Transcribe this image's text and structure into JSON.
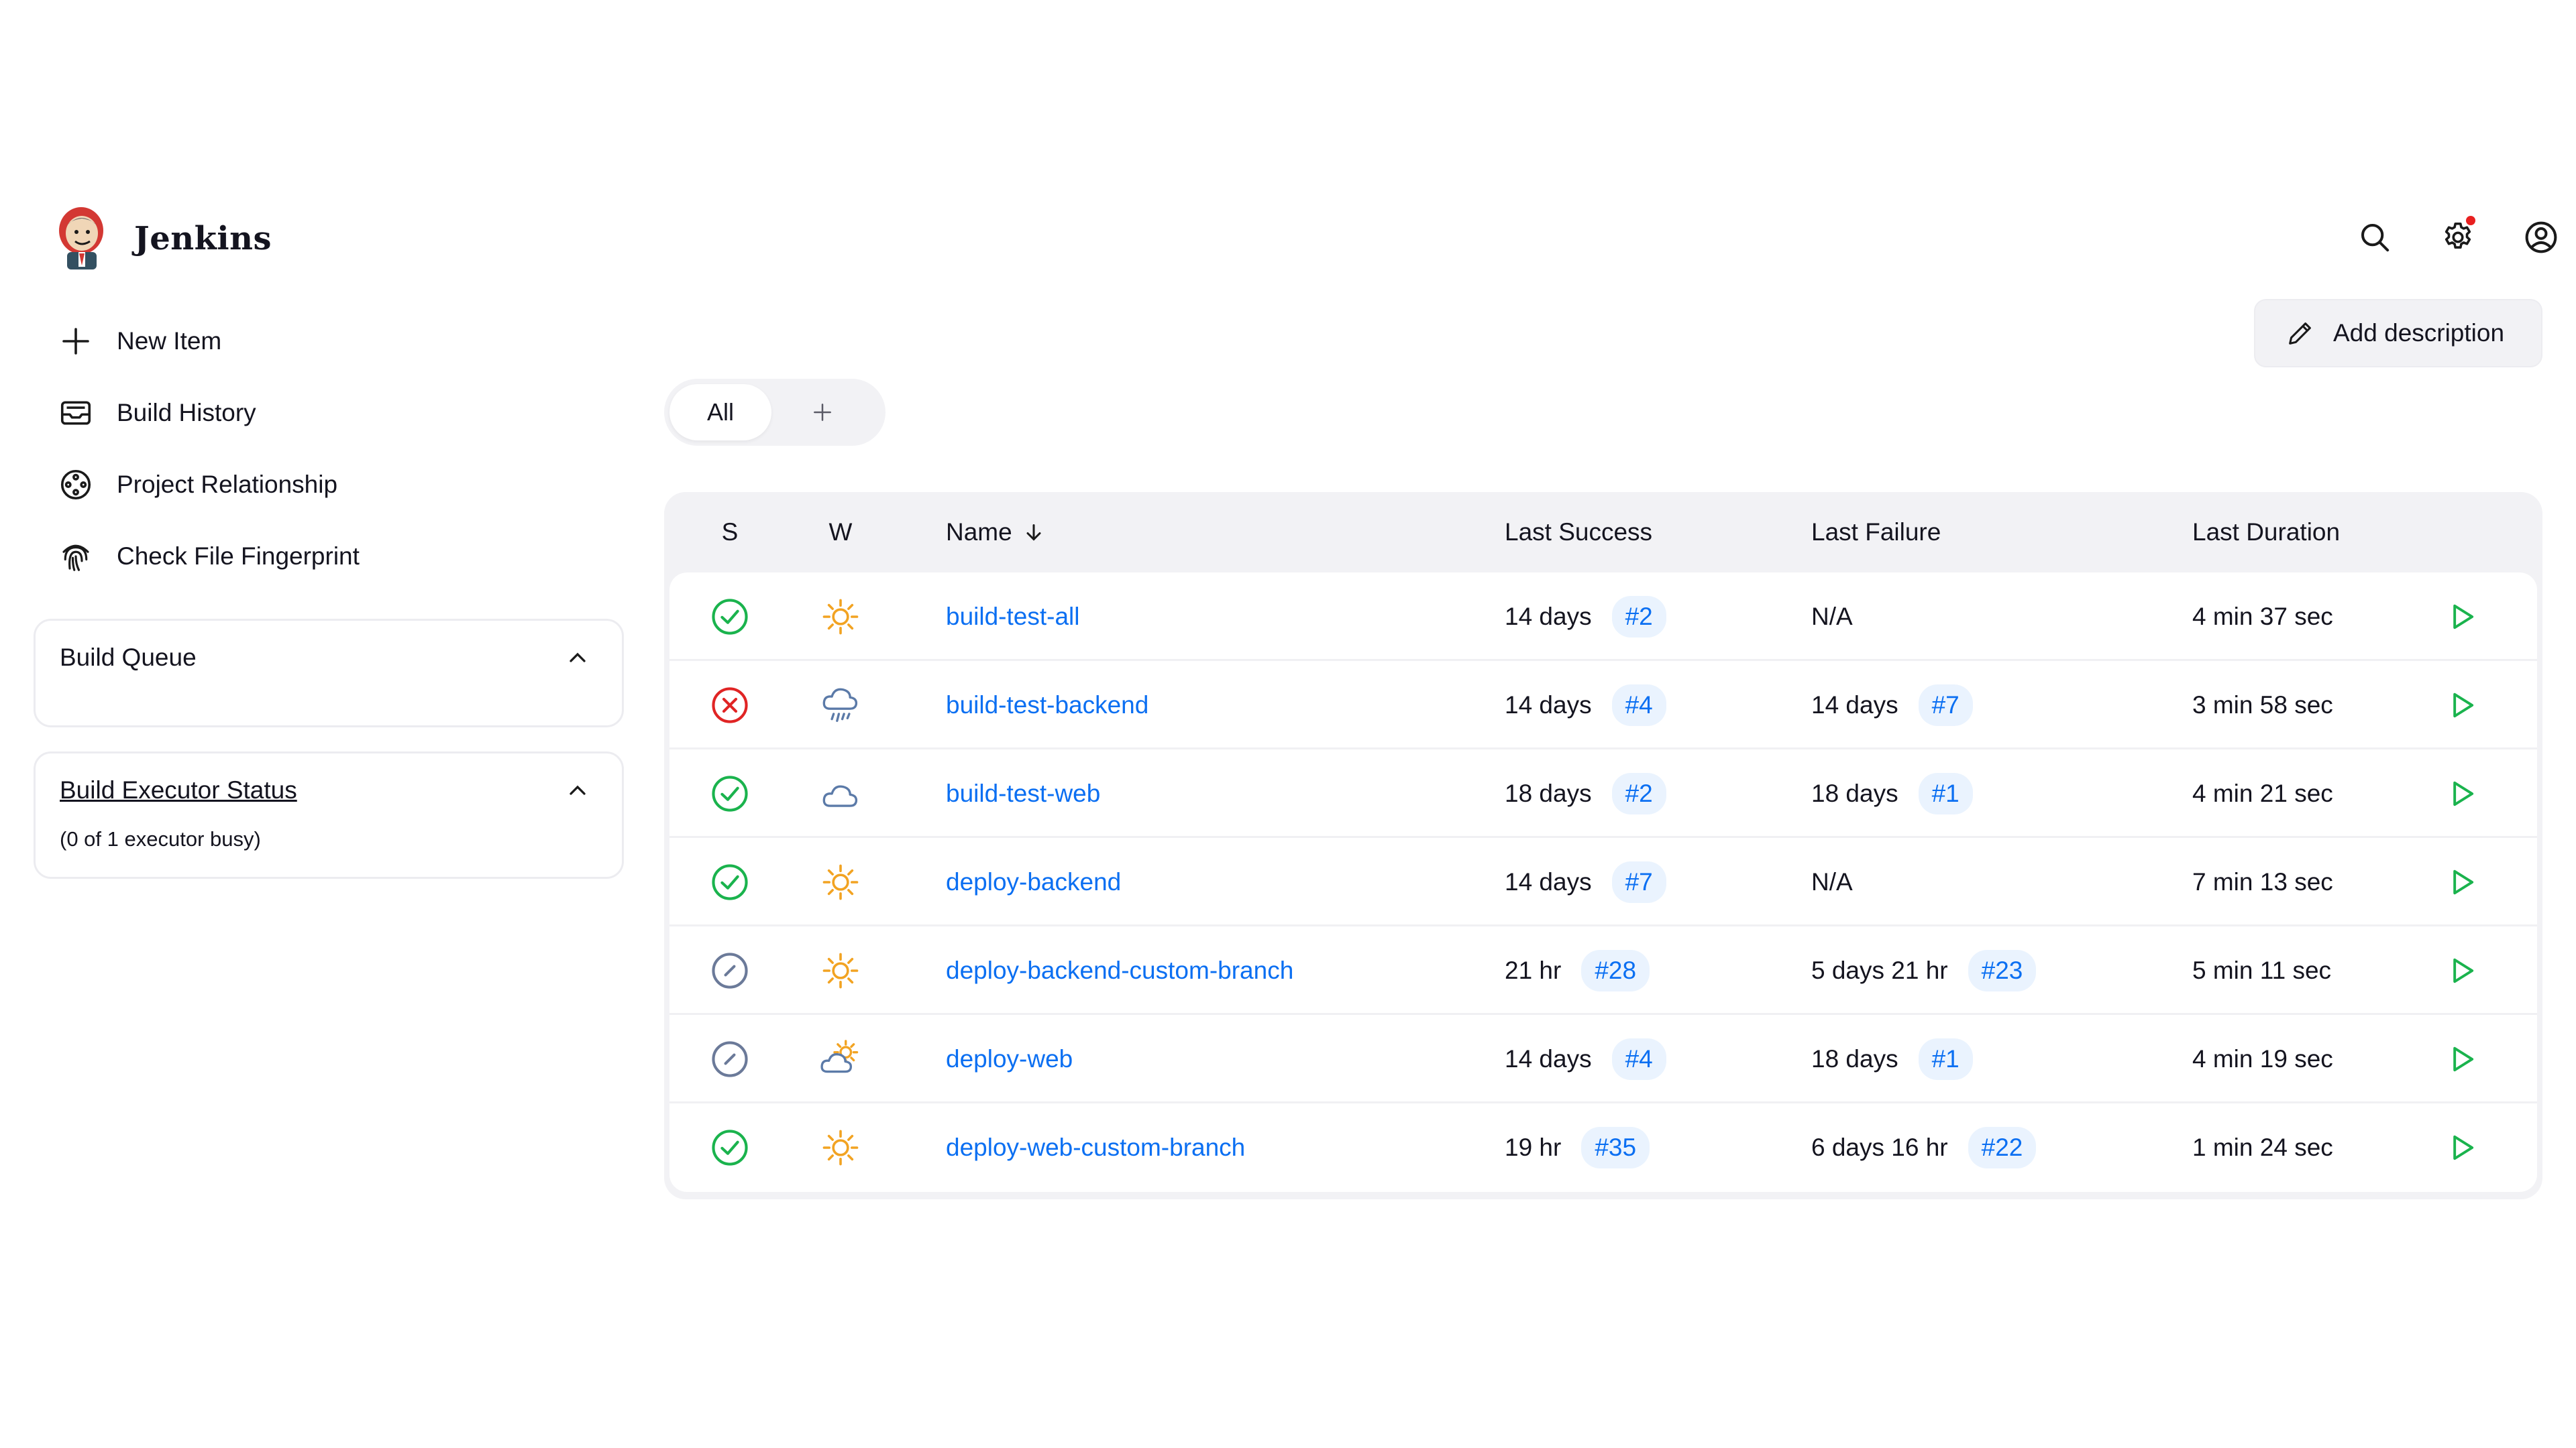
{
  "app": {
    "title": "Jenkins"
  },
  "header": {
    "icons": [
      "search-icon",
      "gear-icon",
      "user-icon"
    ],
    "notification": true
  },
  "sidebar": {
    "tasks": [
      {
        "label": "New Item",
        "icon": "plus-icon"
      },
      {
        "label": "Build History",
        "icon": "build-history-icon"
      },
      {
        "label": "Project Relationship",
        "icon": "project-relationship-icon"
      },
      {
        "label": "Check File Fingerprint",
        "icon": "fingerprint-icon"
      }
    ],
    "build_queue": {
      "title": "Build Queue"
    },
    "executor": {
      "title": "Build Executor Status",
      "status": "(0 of 1 executor busy)"
    }
  },
  "main": {
    "add_description": "Add description",
    "views": {
      "active": "All"
    }
  },
  "table": {
    "headers": {
      "s": "S",
      "w": "W",
      "name": "Name",
      "last_success": "Last Success",
      "last_failure": "Last Failure",
      "last_duration": "Last Duration"
    },
    "rows": [
      {
        "status": "success",
        "weather": "sunny",
        "name": "build-test-all",
        "ls_time": "14 days",
        "ls_build": "#2",
        "lf_time": "N/A",
        "lf_build": "",
        "duration": "4 min 37 sec"
      },
      {
        "status": "failed",
        "weather": "rain",
        "name": "build-test-backend",
        "ls_time": "14 days",
        "ls_build": "#4",
        "lf_time": "14 days",
        "lf_build": "#7",
        "duration": "3 min 58 sec"
      },
      {
        "status": "success",
        "weather": "cloudy",
        "name": "build-test-web",
        "ls_time": "18 days",
        "ls_build": "#2",
        "lf_time": "18 days",
        "lf_build": "#1",
        "duration": "4 min 21 sec"
      },
      {
        "status": "success",
        "weather": "sunny",
        "name": "deploy-backend",
        "ls_time": "14 days",
        "ls_build": "#7",
        "lf_time": "N/A",
        "lf_build": "",
        "duration": "7 min 13 sec"
      },
      {
        "status": "aborted",
        "weather": "sunny",
        "name": "deploy-backend-custom-branch",
        "ls_time": "21 hr",
        "ls_build": "#28",
        "lf_time": "5 days 21 hr",
        "lf_build": "#23",
        "duration": "5 min 11 sec"
      },
      {
        "status": "aborted",
        "weather": "partly-cloudy",
        "name": "deploy-web",
        "ls_time": "14 days",
        "ls_build": "#4",
        "lf_time": "18 days",
        "lf_build": "#1",
        "duration": "4 min 19 sec"
      },
      {
        "status": "success",
        "weather": "sunny",
        "name": "deploy-web-custom-branch",
        "ls_time": "19 hr",
        "ls_build": "#35",
        "lf_time": "6 days 16 hr",
        "lf_build": "#22",
        "duration": "1 min 24 sec"
      }
    ]
  },
  "colors": {
    "link": "#0b6ff2",
    "success": "#1ab34d",
    "failed": "#e02424",
    "aborted": "#6b7a99",
    "sun": "#f2a322",
    "cloud": "#5b7aa8"
  }
}
